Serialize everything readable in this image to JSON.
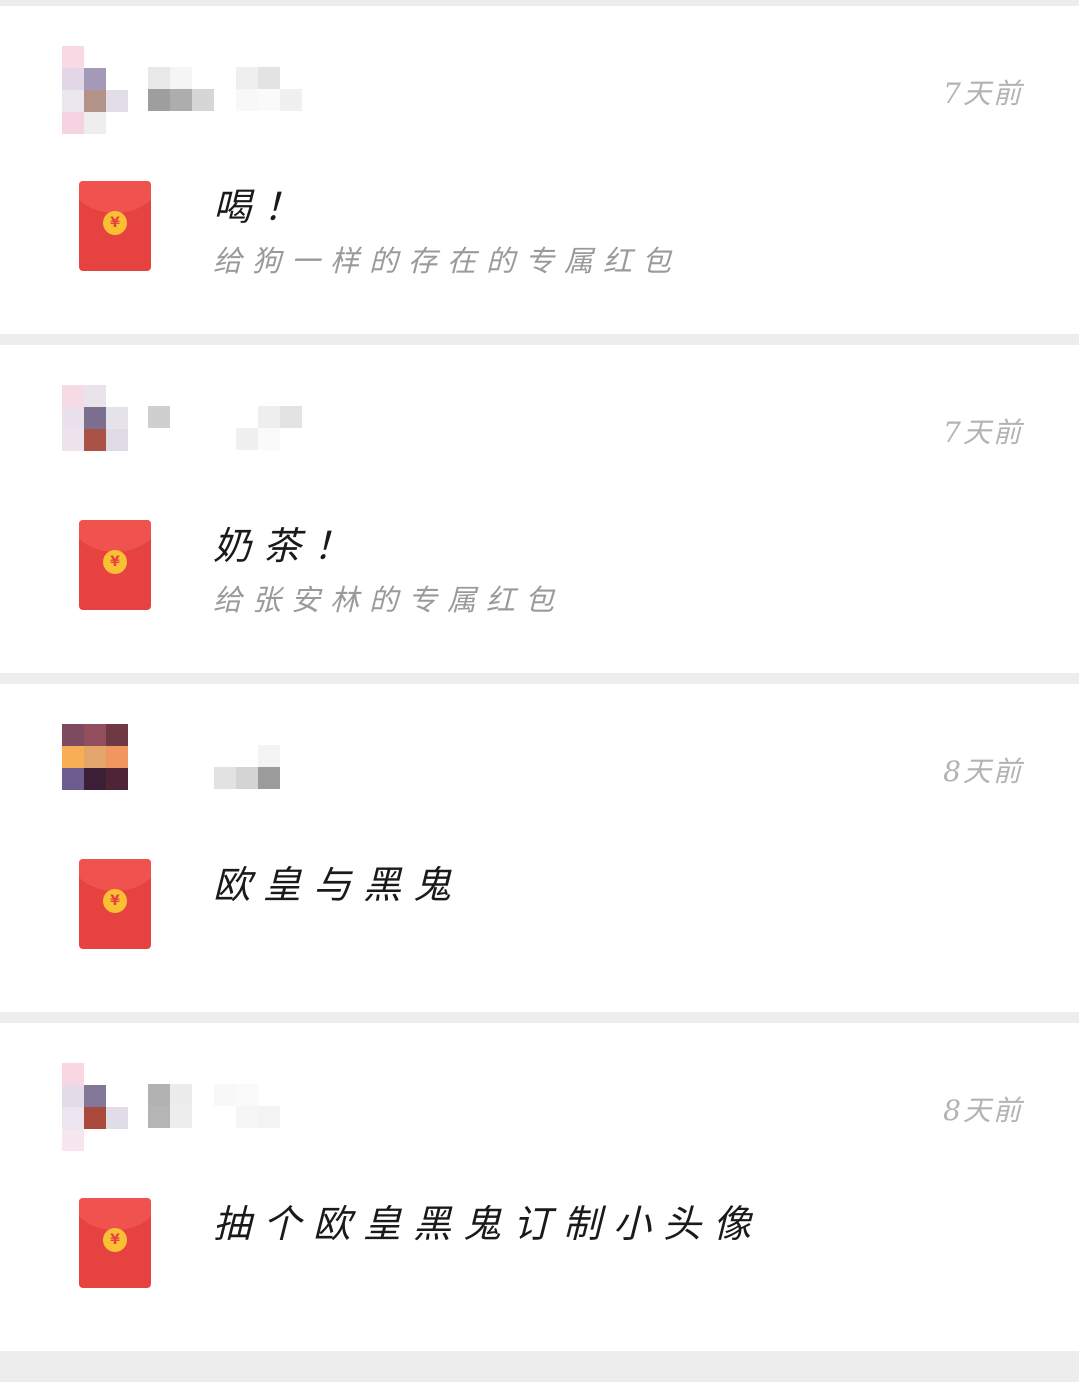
{
  "colors": {
    "page_background": "#ededed",
    "card_background": "#ffffff",
    "envelope_red": "#e64340",
    "coin_gold": "#f9c033",
    "time_gray": "#b3b3b3"
  },
  "envelope_icon": {
    "name": "red-envelope-icon",
    "coin_symbol": "¥"
  },
  "posts": [
    {
      "time": "7天前",
      "title": "喝！",
      "subtitle": "给狗一样的存在的专属红包",
      "avatar_colors": [
        "#f8d9e4",
        "#ffffff",
        "#ffffff",
        "#e2d7e6",
        "#a49ab7",
        "#ffffff",
        "#ece6ee",
        "#b39287",
        "#e2dee9",
        "#f5d3e0",
        "#eeeeee",
        "#ffffff"
      ],
      "nickname_colors": [
        "#e8e8e8",
        "#f5f5f5",
        "#ffffff",
        "#ffffff",
        "#efefef",
        "#e3e3e3",
        "#ffffff",
        "#ffffff",
        "#9e9e9e",
        "#adadad",
        "#d6d6d6",
        "#ffffff",
        "#f8f8f8",
        "#fafafa",
        "#f0f0f0",
        "#ffffff"
      ]
    },
    {
      "time": "7天前",
      "title": "奶茶！",
      "subtitle": "给张安林的专属红包",
      "avatar_colors": [
        "#f7dbe4",
        "#e8e4ea",
        "#ffffff",
        "#ebe1ec",
        "#7c6f8f",
        "#e5e2ea",
        "#ede3ec",
        "#a85346",
        "#dfdbe6",
        "#ffffff",
        "#ffffff",
        "#ffffff"
      ],
      "nickname_colors": [
        "#cfcfcf",
        "#ffffff",
        "#ffffff",
        "#ffffff",
        "#ffffff",
        "#eeeeee",
        "#e3e3e3",
        "#ffffff",
        "#ffffff",
        "#ffffff",
        "#ffffff",
        "#ffffff",
        "#f0f0f0",
        "#fafafa",
        "#ffffff",
        "#ffffff"
      ]
    },
    {
      "time": "8天前",
      "title": "欧皇与黑鬼",
      "subtitle": "",
      "avatar_colors": [
        "#7e4a60",
        "#924e5c",
        "#6e3844",
        "#f7ae55",
        "#e4a56b",
        "#f0965e",
        "#6e5b8f",
        "#3a1f36",
        "#4d2537",
        "#ffffff",
        "#ffffff",
        "#ffffff"
      ],
      "nickname_colors": [
        "#ffffff",
        "#ffffff",
        "#ffffff",
        "#ffffff",
        "#ffffff",
        "#f3f3f3",
        "#ffffff",
        "#ffffff",
        "#ffffff",
        "#ffffff",
        "#ffffff",
        "#e2e2e2",
        "#d4d4d4",
        "#9b9b9b",
        "#ffffff",
        "#ffffff"
      ]
    },
    {
      "time": "8天前",
      "title": "抽个欧皇黑鬼订制小头像",
      "subtitle": "",
      "avatar_colors": [
        "#f8d7e2",
        "#ffffff",
        "#ffffff",
        "#e4dbe9",
        "#847898",
        "#ffffff",
        "#ece4ef",
        "#aa4a3c",
        "#e0dce8",
        "#f8e6ee",
        "#ffffff",
        "#ffffff"
      ],
      "nickname_colors": [
        "#b2b2b2",
        "#ececec",
        "#ffffff",
        "#f8f8f8",
        "#fafafa",
        "#ffffff",
        "#ffffff",
        "#ffffff",
        "#b5b5b5",
        "#ededed",
        "#ffffff",
        "#ffffff",
        "#f6f6f6",
        "#f3f3f3",
        "#ffffff",
        "#ffffff"
      ]
    }
  ]
}
